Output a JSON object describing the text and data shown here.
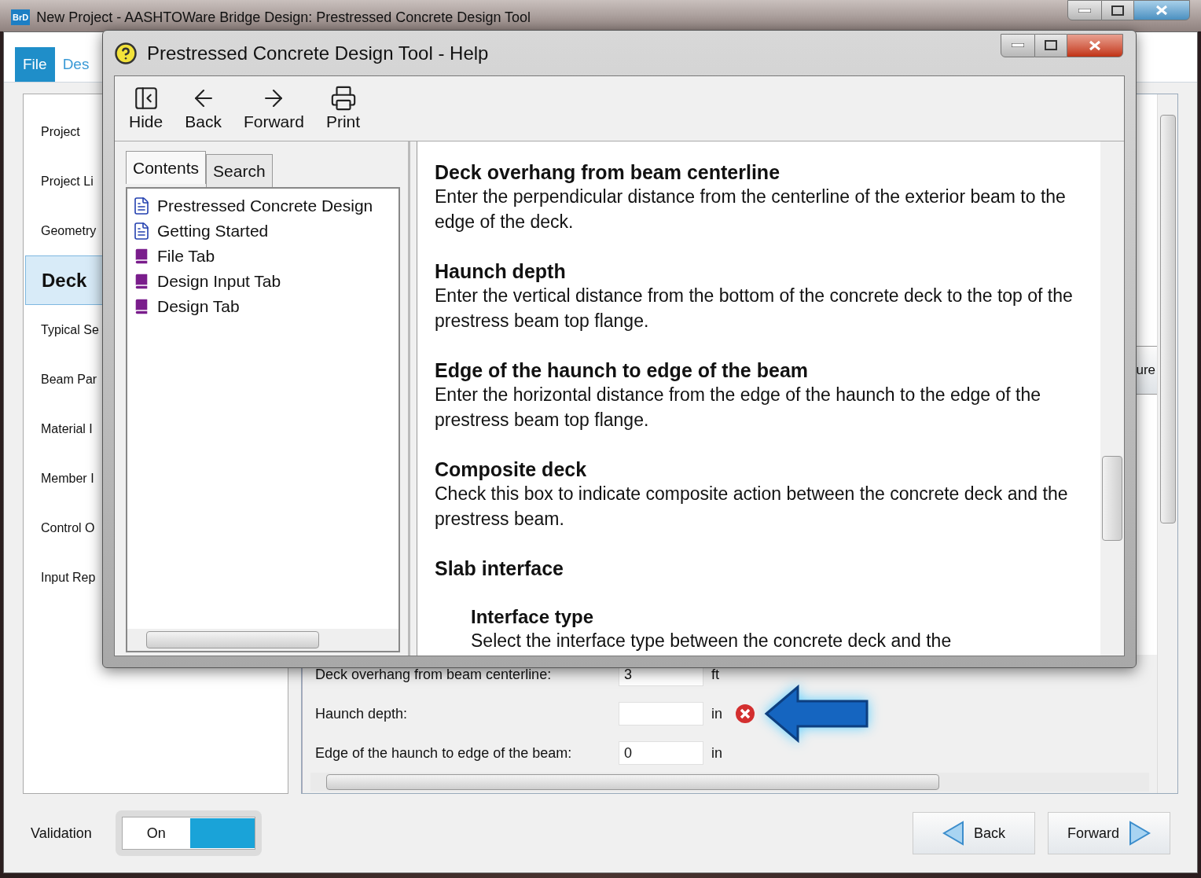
{
  "main_window": {
    "logo": "BrD",
    "title": "New Project - AASHTOWare Bridge Design: Prestressed Concrete Design Tool"
  },
  "ribbon_tabs": [
    {
      "label": "File",
      "selected": true
    },
    {
      "label": "Des",
      "selected": false
    }
  ],
  "sidebar": {
    "items": [
      {
        "label": "Project",
        "selected": false
      },
      {
        "label": "Project Li",
        "selected": false
      },
      {
        "label": "Geometry",
        "selected": false
      },
      {
        "label": "Deck",
        "selected": true
      },
      {
        "label": "Typical Se",
        "selected": false
      },
      {
        "label": "Beam Par",
        "selected": false
      },
      {
        "label": "Material I",
        "selected": false
      },
      {
        "label": "Member I",
        "selected": false
      },
      {
        "label": "Control O",
        "selected": false
      },
      {
        "label": "Input Rep",
        "selected": false
      }
    ]
  },
  "content": {
    "partial_button": "ure",
    "fields": [
      {
        "label": "Deck overhang from beam centerline:",
        "value": "3",
        "unit": "ft",
        "error": false
      },
      {
        "label": "Haunch depth:",
        "unit": "in",
        "error": true
      },
      {
        "label": "Edge of the haunch to edge of the beam:",
        "value": "0",
        "unit": "in",
        "error": false
      }
    ]
  },
  "validation": {
    "label": "Validation",
    "toggle_text": "On",
    "on": true
  },
  "nav_buttons": [
    {
      "label": "Back",
      "kind": "back"
    },
    {
      "label": "Forward",
      "kind": "forward"
    }
  ],
  "help_window": {
    "title": "Prestressed Concrete Design Tool - Help",
    "toolbar": [
      {
        "label": "Hide",
        "kind": "hide"
      },
      {
        "label": "Back",
        "kind": "back"
      },
      {
        "label": "Forward",
        "kind": "forward"
      },
      {
        "label": "Print",
        "kind": "print"
      }
    ],
    "tabs": [
      {
        "label": "Contents",
        "selected": true
      },
      {
        "label": "Search",
        "selected": false
      }
    ],
    "tree": [
      {
        "label": "Prestressed Concrete Design",
        "kind": "page"
      },
      {
        "label": "Getting Started",
        "kind": "page"
      },
      {
        "label": "File Tab",
        "kind": "book"
      },
      {
        "label": "Design Input Tab",
        "kind": "book"
      },
      {
        "label": "Design Tab",
        "kind": "book"
      }
    ],
    "topic": [
      {
        "kind": "heading",
        "text": "Deck overhang from beam centerline"
      },
      {
        "kind": "body",
        "text": "Enter the perpendicular distance from the centerline of the exterior beam to the edge of the deck."
      },
      {
        "kind": "heading",
        "text": "Haunch depth"
      },
      {
        "kind": "body",
        "text": "Enter the vertical distance from the bottom of the concrete deck to the top of the prestress beam top flange."
      },
      {
        "kind": "heading",
        "text": "Edge of the haunch to edge of the beam"
      },
      {
        "kind": "body",
        "text": "Enter the horizontal distance from the edge of the haunch to the edge of the prestress beam top flange."
      },
      {
        "kind": "heading",
        "text": "Composite deck"
      },
      {
        "kind": "body",
        "text": "Check this box to indicate composite action between the concrete deck and the prestress beam."
      },
      {
        "kind": "heading",
        "text": "Slab interface"
      },
      {
        "kind": "subheading",
        "text": "Interface type"
      },
      {
        "kind": "subbody",
        "text": "Select the interface type between the concrete deck and the"
      }
    ]
  }
}
